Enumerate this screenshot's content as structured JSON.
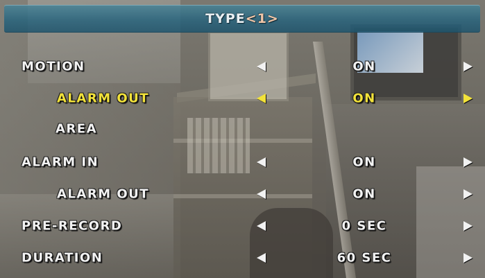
{
  "title": {
    "name": "TYPE",
    "page": "<1>"
  },
  "menu": [
    {
      "label": "MOTION",
      "value": "ON",
      "selected": false
    },
    {
      "label": "ALARM OUT",
      "value": "ON",
      "selected": true
    },
    {
      "label": "AREA",
      "value": "",
      "selected": false
    },
    {
      "label": "ALARM IN",
      "value": "ON",
      "selected": false
    },
    {
      "label": "ALARM OUT",
      "value": "ON",
      "selected": false
    },
    {
      "label": "PRE-RECORD",
      "value": "0 SEC",
      "selected": false
    },
    {
      "label": "DURATION",
      "value": "60 SEC",
      "selected": false
    }
  ],
  "colors": {
    "text": "#f2f2f2",
    "selected": "#f2e23a",
    "title_bar": "#2f6f8a",
    "title_page": "#f0c6a8"
  },
  "icons": {
    "left": "left-triangle-icon",
    "right": "right-triangle-icon"
  }
}
